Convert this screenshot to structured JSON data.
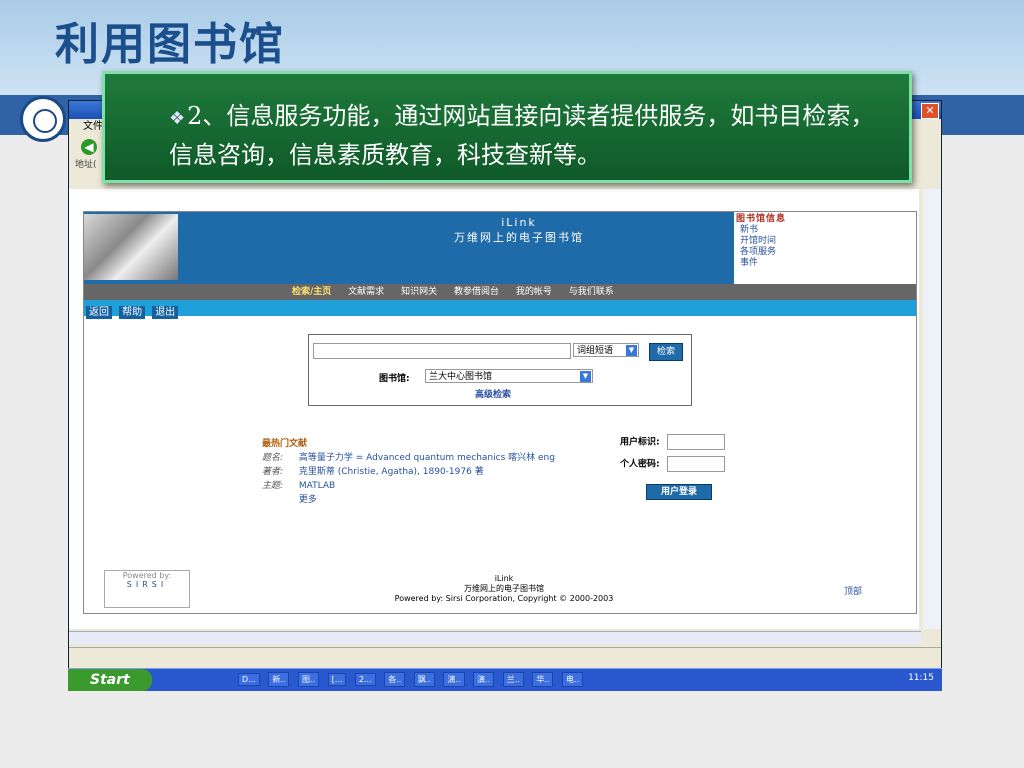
{
  "slide": {
    "title": "利用图书馆",
    "overlay_text": "2、信息服务功能，通过网站直接向读者提供服务，如书目检索，信息咨询，信息素质教育，科技查新等。"
  },
  "browser": {
    "menu_label": "文件",
    "address_label": "地址("
  },
  "page": {
    "banner_title_1": "iLink",
    "banner_title_2": "万维网上的电子图书馆",
    "info_head": "图书馆信息",
    "info_links": [
      "新书",
      "开馆时间",
      "各项服务",
      "事件"
    ],
    "tabs": [
      "检索/主页",
      "文献需求",
      "知识网关",
      "教参借阅台",
      "我的帐号",
      "与我们联系"
    ],
    "buttons": [
      "返回",
      "帮助",
      "退出"
    ],
    "search": {
      "select_value": "词组短语",
      "button": "检索",
      "library_label": "图书馆:",
      "library_value": "兰大中心图书馆",
      "advanced": "高级检索"
    },
    "hot": {
      "head": "最热门文献",
      "rows": [
        {
          "k": "题名:",
          "v": "高等量子力学 = Advanced quantum mechanics 喀兴林 eng"
        },
        {
          "k": "著者:",
          "v": "克里斯蒂 (Christie, Agatha), 1890-1976 著"
        },
        {
          "k": "主题:",
          "v": "MATLAB"
        }
      ],
      "more": "更多"
    },
    "login": {
      "user_label": "用户标识:",
      "pin_label": "个人密码:",
      "button": "用户登录"
    },
    "footer": {
      "powered": "Powered by:",
      "sirsi": "SIRSI",
      "line1": "iLink",
      "line2": "万维网上的电子图书馆",
      "line3": "Powered by: Sirsi Corporation, Copyright © 2000-2003",
      "top_link": "顶部"
    }
  },
  "taskbar": {
    "start": "Start",
    "tasks": [
      "D...",
      "新..",
      "图..",
      "[...",
      "2...",
      "各..",
      "飘..",
      "演..",
      "演..",
      "兰..",
      "华..",
      "电.."
    ],
    "clock": "11:15"
  }
}
